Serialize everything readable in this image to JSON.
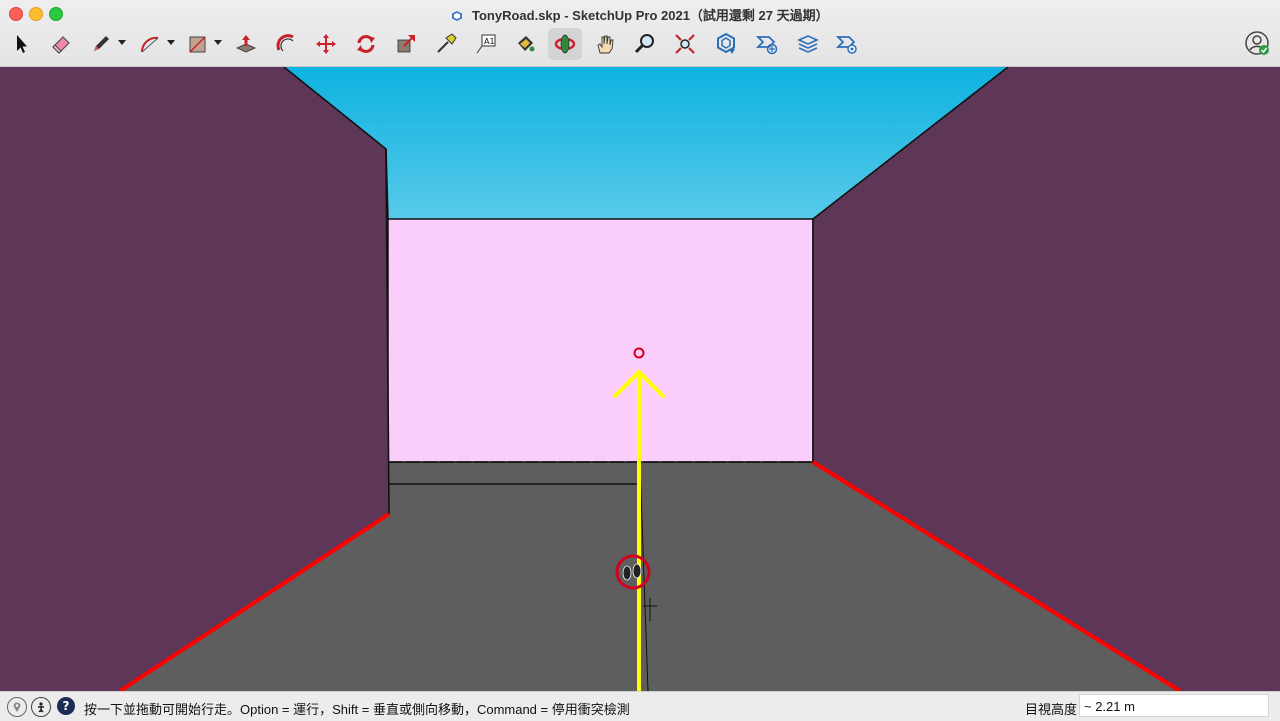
{
  "window": {
    "title": "TonyRoad.skp - SketchUp Pro 2021（試用還剩 27 天過期）",
    "doc_icon": "sketchup-doc-icon"
  },
  "toolbar": {
    "tools": [
      {
        "name": "select-tool",
        "icon": "arrow-cursor-icon"
      },
      {
        "name": "eraser-tool",
        "icon": "eraser-icon"
      },
      {
        "name": "line-tool",
        "icon": "pencil-icon",
        "dropdown": true
      },
      {
        "name": "arc-tool",
        "icon": "arc-icon",
        "dropdown": true
      },
      {
        "name": "rectangle-tool",
        "icon": "rectangle-icon",
        "dropdown": true
      },
      {
        "name": "push-pull-tool",
        "icon": "push-pull-icon"
      },
      {
        "name": "offset-tool",
        "icon": "offset-icon"
      },
      {
        "name": "move-tool",
        "icon": "move-arrows-icon"
      },
      {
        "name": "rotate-tool",
        "icon": "rotate-icon"
      },
      {
        "name": "scale-tool",
        "icon": "scale-icon"
      },
      {
        "name": "tape-measure-tool",
        "icon": "tape-measure-icon"
      },
      {
        "name": "text-tool",
        "icon": "text-a1-icon"
      },
      {
        "name": "paint-bucket-tool",
        "icon": "paint-bucket-icon"
      },
      {
        "name": "orbit-tool",
        "icon": "orbit-icon",
        "active": true
      },
      {
        "name": "pan-tool",
        "icon": "hand-icon"
      },
      {
        "name": "zoom-tool",
        "icon": "magnifier-icon"
      },
      {
        "name": "zoom-extents-tool",
        "icon": "zoom-extents-icon"
      },
      {
        "name": "warehouse-tool",
        "icon": "3d-warehouse-icon"
      },
      {
        "name": "extension-warehouse-tool",
        "icon": "extension-warehouse-icon"
      },
      {
        "name": "layout-send-tool",
        "icon": "send-to-layout-icon"
      },
      {
        "name": "extension-manager-tool",
        "icon": "extension-manager-icon"
      }
    ],
    "profile_icon": "user-profile-icon"
  },
  "colors": {
    "wall": "#5e3758",
    "back_wall": "#facdfb",
    "floor": "#5e5e5e",
    "sky_top": "#0eb2e0",
    "sky_bottom": "#5ccbea",
    "edge_highlight": "#ff0000",
    "walk_arrow": "#ffff00"
  },
  "status": {
    "message": "按一下並拖動可開始行走。Option = 運行，Shift = 垂直或側向移動，Command = 停用衝突檢測",
    "eye_height_label": "目視高度",
    "eye_height_value": "~ 2.21 m",
    "icons": [
      "location-pin-icon",
      "instructor-icon",
      "help-icon"
    ]
  }
}
